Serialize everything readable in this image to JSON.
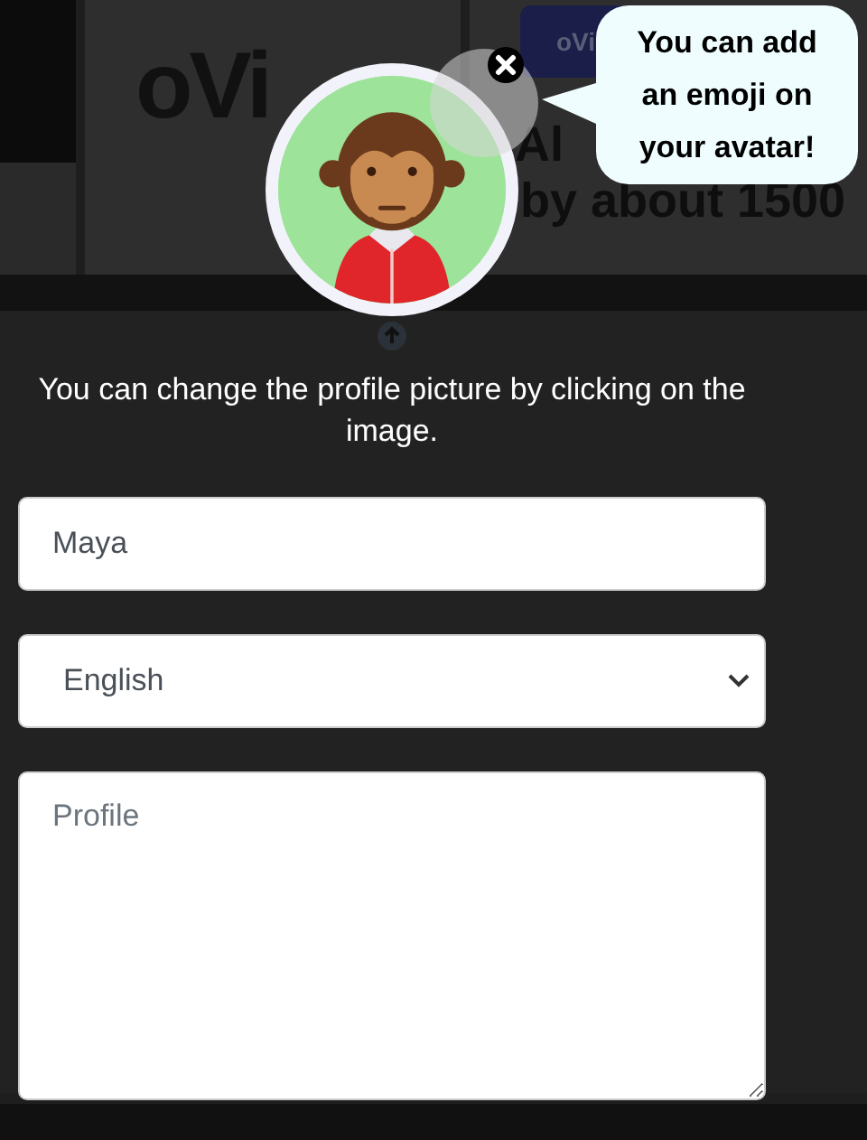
{
  "background": {
    "logo": "oVi",
    "button": "oVi",
    "headline": [
      "Al",
      "by about 1500"
    ]
  },
  "avatar": {
    "kind": "monkey"
  },
  "tooltip": {
    "text": "You can add an emoji on your avatar!"
  },
  "hint": "You can change the profile picture by clicking on the image.",
  "form": {
    "name": {
      "value": "Maya"
    },
    "language": {
      "value": "English"
    },
    "profile": {
      "placeholder": "Profile"
    }
  }
}
